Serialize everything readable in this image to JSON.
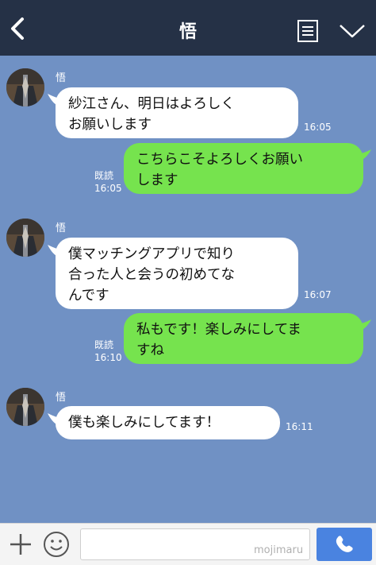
{
  "header": {
    "title": "悟"
  },
  "messages": [
    {
      "side": "in",
      "sender": "悟",
      "text": "紗江さん、明日はよろしく\nお願いします",
      "time": "16:05"
    },
    {
      "side": "out",
      "text": "こちらこそよろしくお願い\nします",
      "read": "既読",
      "time": "16:05"
    },
    {
      "side": "in",
      "sender": "悟",
      "text": "僕マッチングアプリで知り\n合った人と会うの初めてな\nんです",
      "time": "16:07"
    },
    {
      "side": "out",
      "text": "私もです！楽しみにしてま\nすね",
      "read": "既読",
      "time": "16:10"
    },
    {
      "side": "in",
      "sender": "悟",
      "text": "僕も楽しみにしてます！",
      "time": "16:11"
    }
  ],
  "footer": {
    "input_value": "",
    "watermark": "mojimaru"
  },
  "colors": {
    "header_bg": "#253146",
    "chat_bg": "#7091c4",
    "incoming_bubble": "#ffffff",
    "outgoing_bubble": "#76e34e",
    "call_button": "#4a83e0"
  },
  "icons": {
    "back": "chevron-left-icon",
    "menu": "note-menu-icon",
    "collapse": "chevron-down-icon",
    "add": "plus-icon",
    "emoji": "smile-icon",
    "call": "phone-icon"
  }
}
